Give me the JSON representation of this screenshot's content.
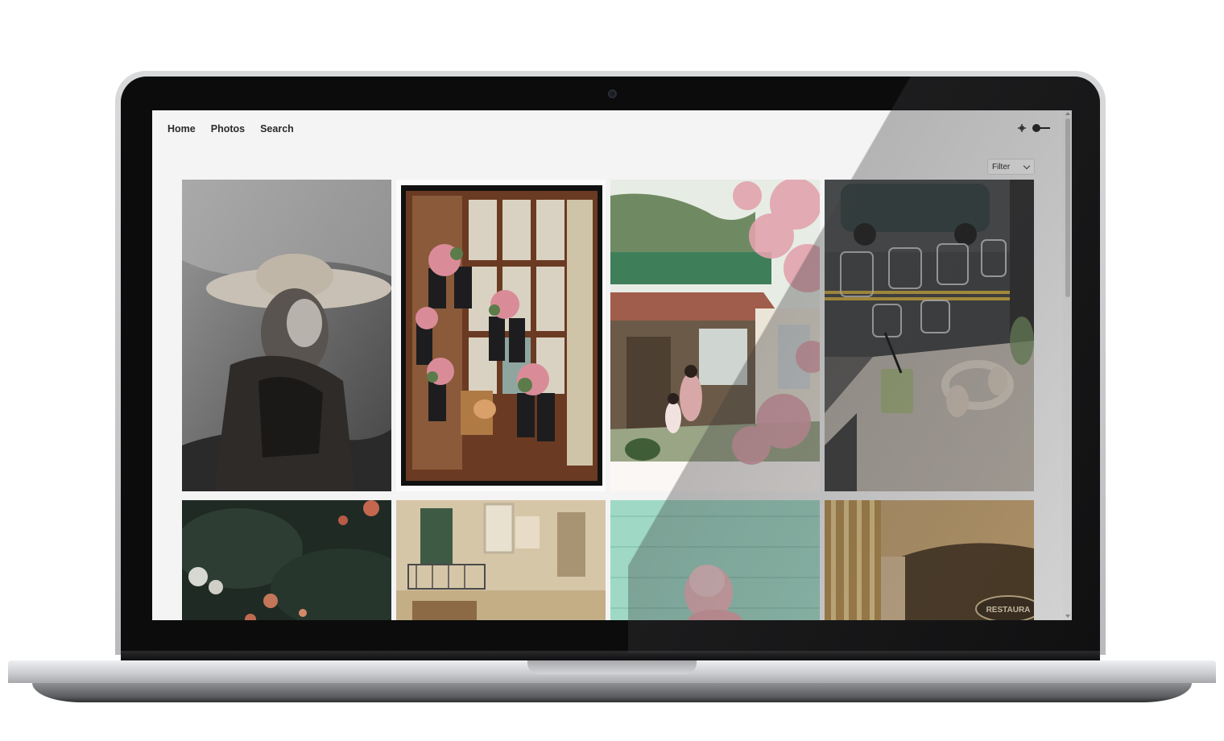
{
  "nav": {
    "items": [
      "Home",
      "Photos",
      "Search"
    ]
  },
  "header": {
    "theme_icon": "sun-icon",
    "toggle_icon": "theme-toggle-icon"
  },
  "filter": {
    "label": "Filter",
    "icon": "chevron-down-icon"
  },
  "photos": [
    {
      "name": "photo-girl-straw-hat"
    },
    {
      "name": "photo-boots-flower-window"
    },
    {
      "name": "photo-wooden-house-blossoms"
    },
    {
      "name": "photo-cafe-window-headphones"
    },
    {
      "name": "photo-dark-foliage-flowers"
    },
    {
      "name": "photo-building-balconies"
    },
    {
      "name": "photo-pink-ice-cream"
    },
    {
      "name": "photo-restaurant-sign"
    }
  ],
  "colors": {
    "screen_bg": "#f4f4f4",
    "nav_text": "#2b2b2b",
    "bezel": "#0c0c0d"
  }
}
